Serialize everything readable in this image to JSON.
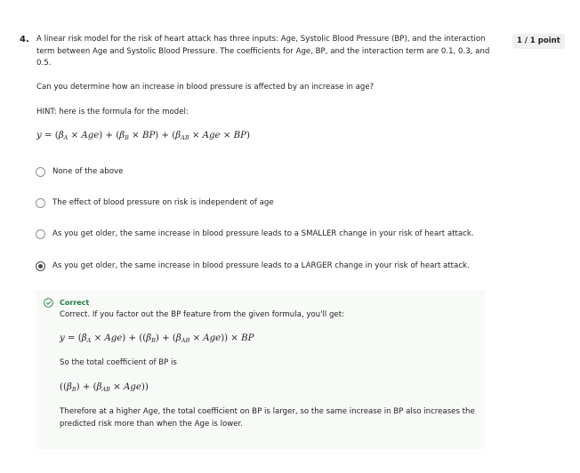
{
  "question": {
    "number": "4.",
    "points": "1 / 1 point",
    "text": "A linear risk model for the risk of heart attack has three inputs: Age, Systolic Blood Pressure (BP), and the interaction term between Age and Systolic Blood Pressure.  The coefficients for Age, BP, and the interaction term are 0.1, 0.3, and 0.5.",
    "prompt": "Can you determine how an increase in blood pressure is affected by an increase in age?",
    "hint": "HINT: here is the formula for the model:"
  },
  "options": [
    {
      "label": "None of the above",
      "selected": false
    },
    {
      "label": "The effect of blood pressure on risk is independent of age",
      "selected": false
    },
    {
      "label": "As you get older, the same increase in blood pressure leads to a SMALLER change in your risk of heart attack.",
      "selected": false
    },
    {
      "label": "As you get older, the same increase in blood pressure leads to a LARGER change in your risk of heart attack.",
      "selected": true
    }
  ],
  "feedback": {
    "status": "Correct",
    "line1": "Correct.  If you factor out the BP feature from the given formula, you'll get:",
    "line2": "So the total coefficient of BP is",
    "line3": "Therefore at a higher Age, the total coefficient on BP is larger, so the same increase in BP also increases the predicted risk more than when the Age is lower."
  },
  "colors": {
    "correct_green": "#1e7a3e",
    "feedback_bg": "#f7faf7"
  }
}
